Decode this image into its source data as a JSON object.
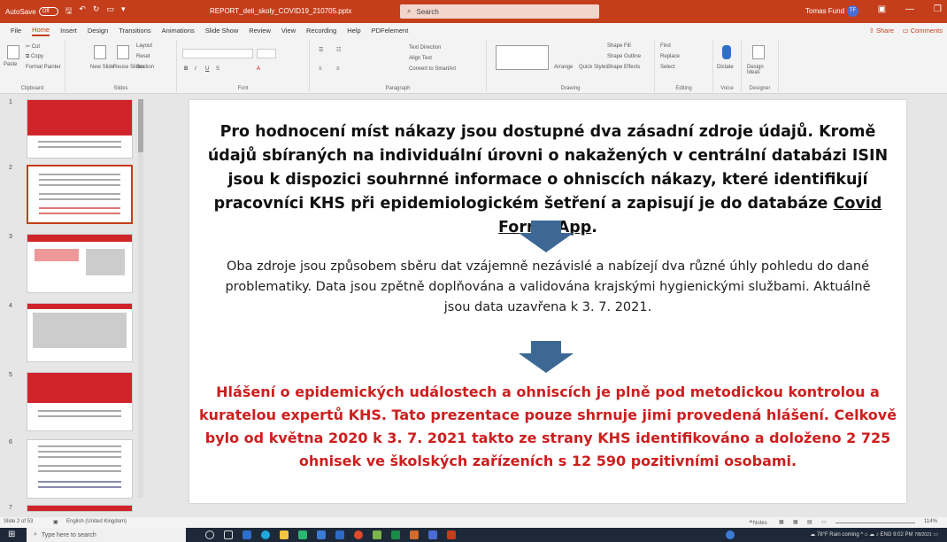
{
  "titlebar": {
    "autosave_label": "AutoSave",
    "autosave_state": "Off",
    "document_title": "REPORT_deti_skoly_COVID19_210705.pptx",
    "search_placeholder": "Search",
    "user_name": "Tomas Fund",
    "user_initials": "TF"
  },
  "menu": {
    "items": [
      "File",
      "Home",
      "Insert",
      "Design",
      "Transitions",
      "Animations",
      "Slide Show",
      "Review",
      "View",
      "Recording",
      "Help",
      "PDFelement"
    ],
    "active": "Home",
    "share": "Share",
    "comments": "Comments"
  },
  "ribbon": {
    "clipboard": {
      "paste": "Paste",
      "cut": "Cut",
      "copy": "Copy",
      "format_painter": "Format Painter",
      "label": "Clipboard"
    },
    "slides": {
      "new_slide": "New Slide",
      "reuse_slides": "Reuse Slides",
      "layout": "Layout",
      "reset": "Reset",
      "section": "Section",
      "label": "Slides"
    },
    "font": {
      "label": "Font"
    },
    "paragraph": {
      "text_direction": "Text Direction",
      "align_text": "Align Text",
      "convert": "Convert to SmartArt",
      "label": "Paragraph"
    },
    "drawing": {
      "arrange": "Arrange",
      "quick_styles": "Quick Styles",
      "shape_fill": "Shape Fill",
      "shape_outline": "Shape Outline",
      "shape_effects": "Shape Effects",
      "label": "Drawing"
    },
    "editing": {
      "find": "Find",
      "replace": "Replace",
      "select": "Select",
      "label": "Editing"
    },
    "voice": {
      "dictate": "Dictate",
      "label": "Voice"
    },
    "designer": {
      "design_ideas": "Design Ideas",
      "label": "Designer"
    }
  },
  "thumbnails": [
    {
      "num": "1"
    },
    {
      "num": "2"
    },
    {
      "num": "3"
    },
    {
      "num": "4"
    },
    {
      "num": "5"
    },
    {
      "num": "6"
    },
    {
      "num": "7"
    }
  ],
  "slide": {
    "p1_part1": "Pro hodnocení míst nákazy jsou dostupné dva zásadní zdroje údajů. Kromě údajů sbíraných na individuální úrovni o nakažených v centrální databázi ISIN jsou k dispozici souhrnné informace o ohniscích nákazy, které identifikují pracovníci KHS při epidemiologickém šetření a zapisují je do databáze ",
    "p1_link": "Covid Forms App",
    "p1_end": ".",
    "p2": "Oba zdroje jsou způsobem sběru dat vzájemně nezávislé a nabízejí dva různé úhly pohledu do dané problematiky. Data jsou zpětně doplňována a validována krajskými hygienickými službami. Aktuálně jsou data uzavřena k 3. 7. 2021.",
    "p3": "Hlášení o epidemických událostech a ohniscích je plně pod metodickou kontrolou a kuratelou expertů KHS. Tato prezentace pouze shrnuje jimi provedená hlášení. Celkově bylo od května 2020 k 3. 7. 2021 takto ze strany KHS identifikováno a doloženo 2 725 ohnisek ve školských zařízeních s 12 590 pozitivními osobami.",
    "arrow_color": "#3d6896",
    "p3_color": "#cc1f1f"
  },
  "statusbar": {
    "slide_counter": "Slide 2 of 53",
    "language": "English (United Kingdom)",
    "notes": "Notes",
    "zoom": "114%"
  },
  "taskbar": {
    "search_placeholder": "Type here to search",
    "weather": "78°F Rain coming",
    "lang": "ENG",
    "time": "9:02 PM",
    "date": "7/8/2021"
  }
}
